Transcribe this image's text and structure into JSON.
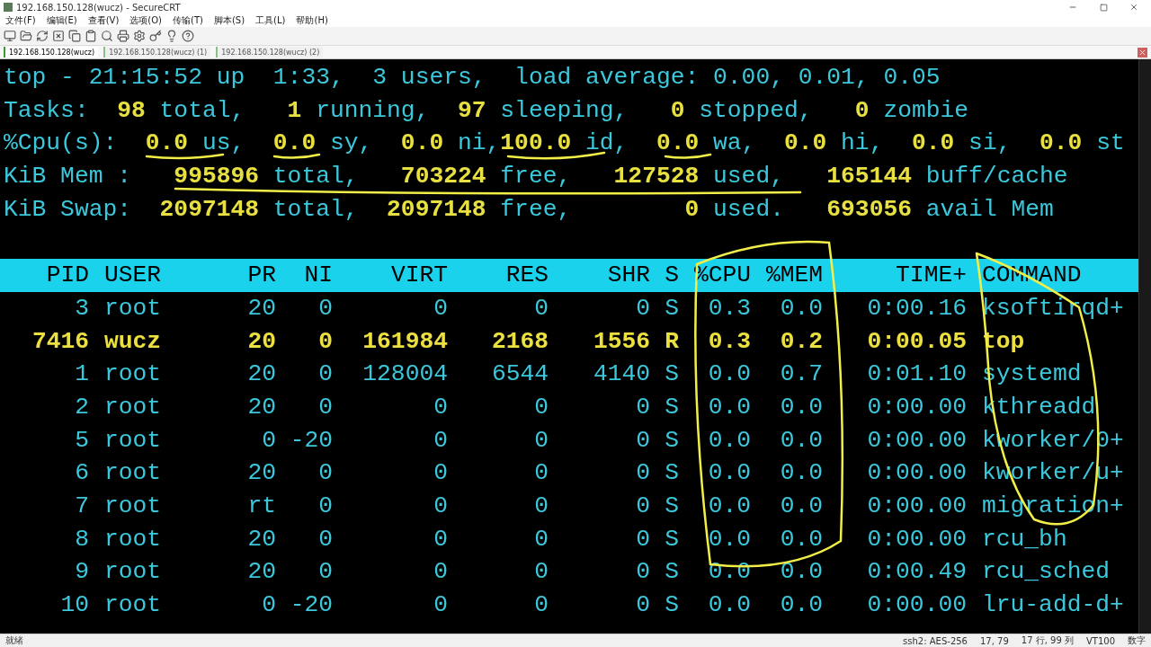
{
  "window": {
    "title": "192.168.150.128(wucz) - SecureCRT"
  },
  "menu": [
    "文件(F)",
    "编辑(E)",
    "查看(V)",
    "选项(O)",
    "传输(T)",
    "脚本(S)",
    "工具(L)",
    "帮助(H)"
  ],
  "tabs": [
    {
      "label": "192.168.150.128(wucz)",
      "selected": true
    },
    {
      "label": "192.168.150.128(wucz) (1)",
      "selected": false
    },
    {
      "label": "192.168.150.128(wucz) (2)",
      "selected": false
    }
  ],
  "summary": [
    [
      {
        "text": "top - 21:15:52 up  1:33,  3 users,  load average: 0.00, 0.01, 0.05",
        "kind": "label"
      }
    ],
    [
      {
        "text": "Tasks:",
        "kind": "label"
      },
      {
        "text": "  98",
        "kind": "value"
      },
      {
        "text": " total,",
        "kind": "label"
      },
      {
        "text": "   1",
        "kind": "value"
      },
      {
        "text": " running,",
        "kind": "label"
      },
      {
        "text": "  97",
        "kind": "value"
      },
      {
        "text": " sleeping,",
        "kind": "label"
      },
      {
        "text": "   0",
        "kind": "value"
      },
      {
        "text": " stopped,",
        "kind": "label"
      },
      {
        "text": "   0",
        "kind": "value"
      },
      {
        "text": " zombie",
        "kind": "label"
      }
    ],
    [
      {
        "text": "%Cpu(s):",
        "kind": "label"
      },
      {
        "text": "  0.0",
        "kind": "value"
      },
      {
        "text": " us,",
        "kind": "label"
      },
      {
        "text": "  0.0",
        "kind": "value"
      },
      {
        "text": " sy,",
        "kind": "label"
      },
      {
        "text": "  0.0",
        "kind": "value"
      },
      {
        "text": " ni,",
        "kind": "label"
      },
      {
        "text": "100.0",
        "kind": "value"
      },
      {
        "text": " id,",
        "kind": "label"
      },
      {
        "text": "  0.0",
        "kind": "value"
      },
      {
        "text": " wa,",
        "kind": "label"
      },
      {
        "text": "  0.0",
        "kind": "value"
      },
      {
        "text": " hi,",
        "kind": "label"
      },
      {
        "text": "  0.0",
        "kind": "value"
      },
      {
        "text": " si,",
        "kind": "label"
      },
      {
        "text": "  0.0",
        "kind": "value"
      },
      {
        "text": " st",
        "kind": "label"
      }
    ],
    [
      {
        "text": "KiB Mem :",
        "kind": "label"
      },
      {
        "text": "   995896",
        "kind": "value"
      },
      {
        "text": " total,",
        "kind": "label"
      },
      {
        "text": "   703224",
        "kind": "value"
      },
      {
        "text": " free,",
        "kind": "label"
      },
      {
        "text": "   127528",
        "kind": "value"
      },
      {
        "text": " used,",
        "kind": "label"
      },
      {
        "text": "   165144",
        "kind": "value"
      },
      {
        "text": " buff/cache",
        "kind": "label"
      }
    ],
    [
      {
        "text": "KiB Swap:",
        "kind": "label"
      },
      {
        "text": "  2097148",
        "kind": "value"
      },
      {
        "text": " total,",
        "kind": "label"
      },
      {
        "text": "  2097148",
        "kind": "value"
      },
      {
        "text": " free,",
        "kind": "label"
      },
      {
        "text": "        0",
        "kind": "value"
      },
      {
        "text": " used.",
        "kind": "label"
      },
      {
        "text": "   693056",
        "kind": "value"
      },
      {
        "text": " avail Mem",
        "kind": "label"
      }
    ]
  ],
  "process_table": {
    "columns": [
      "PID",
      "USER",
      "PR",
      "NI",
      "VIRT",
      "RES",
      "SHR",
      "S",
      "%CPU",
      "%MEM",
      "TIME+",
      "COMMAND"
    ],
    "rows": [
      {
        "running": false,
        "cells": [
          "3",
          "root",
          "20",
          "0",
          "0",
          "0",
          "0",
          "S",
          "0.3",
          "0.0",
          "0:00.16",
          "ksoftirqd+"
        ]
      },
      {
        "running": true,
        "cells": [
          "7416",
          "wucz",
          "20",
          "0",
          "161984",
          "2168",
          "1556",
          "R",
          "0.3",
          "0.2",
          "0:00.05",
          "top"
        ]
      },
      {
        "running": false,
        "cells": [
          "1",
          "root",
          "20",
          "0",
          "128004",
          "6544",
          "4140",
          "S",
          "0.0",
          "0.7",
          "0:01.10",
          "systemd"
        ]
      },
      {
        "running": false,
        "cells": [
          "2",
          "root",
          "20",
          "0",
          "0",
          "0",
          "0",
          "S",
          "0.0",
          "0.0",
          "0:00.00",
          "kthreadd"
        ]
      },
      {
        "running": false,
        "cells": [
          "5",
          "root",
          "0",
          "-20",
          "0",
          "0",
          "0",
          "S",
          "0.0",
          "0.0",
          "0:00.00",
          "kworker/0+"
        ]
      },
      {
        "running": false,
        "cells": [
          "6",
          "root",
          "20",
          "0",
          "0",
          "0",
          "0",
          "S",
          "0.0",
          "0.0",
          "0:00.00",
          "kworker/u+"
        ]
      },
      {
        "running": false,
        "cells": [
          "7",
          "root",
          "rt",
          "0",
          "0",
          "0",
          "0",
          "S",
          "0.0",
          "0.0",
          "0:00.00",
          "migration+"
        ]
      },
      {
        "running": false,
        "cells": [
          "8",
          "root",
          "20",
          "0",
          "0",
          "0",
          "0",
          "S",
          "0.0",
          "0.0",
          "0:00.00",
          "rcu_bh"
        ]
      },
      {
        "running": false,
        "cells": [
          "9",
          "root",
          "20",
          "0",
          "0",
          "0",
          "0",
          "S",
          "0.0",
          "0.0",
          "0:00.49",
          "rcu_sched"
        ]
      },
      {
        "running": false,
        "cells": [
          "10",
          "root",
          "0",
          "-20",
          "0",
          "0",
          "0",
          "S",
          "0.0",
          "0.0",
          "0:00.00",
          "lru-add-d+"
        ]
      }
    ]
  },
  "status_bar": [
    "就绪",
    "ssh2: AES-256",
    "17, 79",
    "17 行, 99 列",
    "VT100",
    "数字"
  ]
}
